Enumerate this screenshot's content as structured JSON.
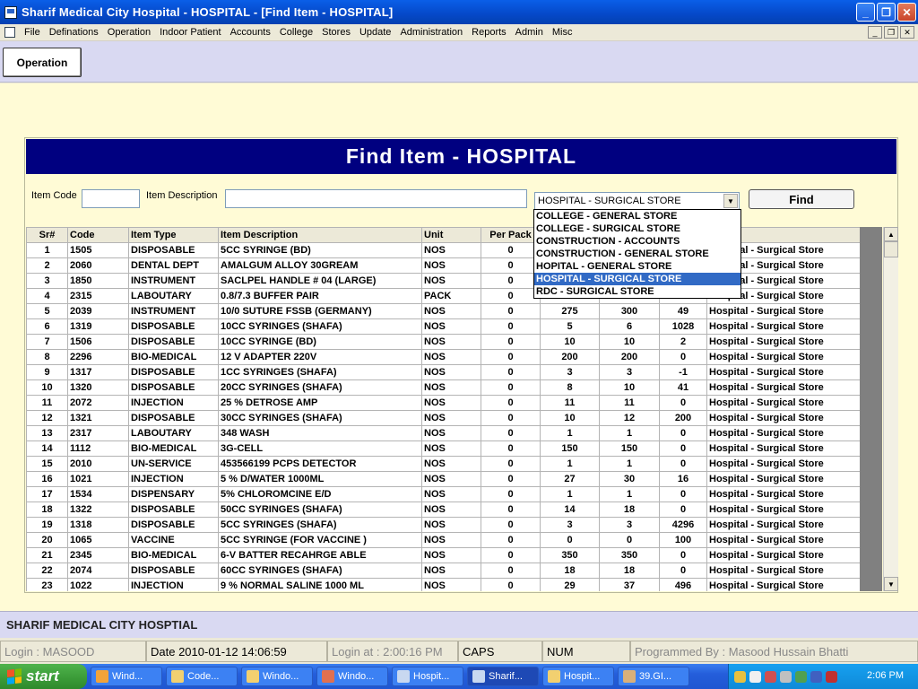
{
  "window": {
    "title": "Sharif Medical City Hospital - HOSPITAL - [Find Item - HOSPITAL]",
    "controls": [
      "_",
      "❐",
      "✕"
    ]
  },
  "menubar": {
    "items": [
      "File",
      "Definations",
      "Operation",
      "Indoor Patient",
      "Accounts",
      "College",
      "Stores",
      "Update",
      "Administration",
      "Reports",
      "Admin",
      "Misc"
    ],
    "mdi_controls": [
      "_",
      "❐",
      "✕"
    ]
  },
  "toolbar": {
    "operation_label": "Operation"
  },
  "find": {
    "header": "Find Item - HOSPITAL",
    "item_code_label": "Item Code",
    "item_code_value": "",
    "item_desc_label": "Item Description",
    "item_desc_value": "",
    "store_selected": "HOSPITAL - SURGICAL STORE",
    "find_label": "Find",
    "store_options": [
      "COLLEGE - GENERAL STORE",
      "COLLEGE - SURGICAL STORE",
      "CONSTRUCTION - ACCOUNTS",
      "CONSTRUCTION - GENERAL STORE",
      "HOPITAL - GENERAL STORE",
      "HOSPITAL - SURGICAL STORE",
      "RDC - SURGICAL STORE"
    ]
  },
  "grid": {
    "columns": [
      "Sr#",
      "Code",
      "Item Type",
      "Item Description",
      "Unit",
      "Per Pack",
      "",
      "",
      "",
      ""
    ],
    "rows": [
      [
        "1",
        "1505",
        "DISPOSABLE",
        " 5CC  SYRINGE (BD)",
        "NOS",
        "0",
        "",
        "",
        "",
        "Hospital - Surgical Store"
      ],
      [
        "2",
        "2060",
        "DENTAL DEPT",
        "  AMALGUM ALLOY 30GREAM",
        "NOS",
        "0",
        "",
        "",
        "",
        "Hospital - Surgical Store"
      ],
      [
        "3",
        "1850",
        "INSTRUMENT",
        "  SACLPEL HANDLE # 04 (LARGE)",
        "NOS",
        "0",
        "",
        "",
        "",
        "Hospital - Surgical Store"
      ],
      [
        "4",
        "2315",
        "LABOUTARY",
        "0.8/7.3 BUFFER PAIR",
        "PACK",
        "0",
        "",
        "",
        "",
        "Hospital - Surgical Store"
      ],
      [
        "5",
        "2039",
        "INSTRUMENT",
        "10/0 SUTURE FSSB (GERMANY)",
        "NOS",
        "0",
        "275",
        "300",
        "49",
        "Hospital - Surgical Store"
      ],
      [
        "6",
        "1319",
        "DISPOSABLE",
        "10CC  SYRINGES (SHAFA)",
        "NOS",
        "0",
        "5",
        "6",
        "1028",
        "Hospital - Surgical Store"
      ],
      [
        "7",
        "1506",
        "DISPOSABLE",
        "10CC SYRINGE  (BD)",
        "NOS",
        "0",
        "10",
        "10",
        "2",
        "Hospital - Surgical Store"
      ],
      [
        "8",
        "2296",
        "BIO-MEDICAL",
        "12 V ADAPTER 220V",
        "NOS",
        "0",
        "200",
        "200",
        "0",
        "Hospital - Surgical Store"
      ],
      [
        "9",
        "1317",
        "DISPOSABLE",
        "1CC  SYRINGES (SHAFA)",
        "NOS",
        "0",
        "3",
        "3",
        "-1",
        "Hospital - Surgical Store"
      ],
      [
        "10",
        "1320",
        "DISPOSABLE",
        "20CC  SYRINGES (SHAFA)",
        "NOS",
        "0",
        "8",
        "10",
        "41",
        "Hospital - Surgical Store"
      ],
      [
        "11",
        "2072",
        "INJECTION",
        "25 % DETROSE AMP",
        "NOS",
        "0",
        "11",
        "11",
        "0",
        "Hospital - Surgical Store"
      ],
      [
        "12",
        "1321",
        "DISPOSABLE",
        "30CC SYRINGES (SHAFA)",
        "NOS",
        "0",
        "10",
        "12",
        "200",
        "Hospital - Surgical Store"
      ],
      [
        "13",
        "2317",
        "LABOUTARY",
        "348 WASH",
        "NOS",
        "0",
        "1",
        "1",
        "0",
        "Hospital - Surgical Store"
      ],
      [
        "14",
        "1112",
        "BIO-MEDICAL",
        "3G-CELL",
        "NOS",
        "0",
        "150",
        "150",
        "0",
        "Hospital - Surgical Store"
      ],
      [
        "15",
        "2010",
        "UN-SERVICE",
        "453566199 PCPS DETECTOR",
        "NOS",
        "0",
        "1",
        "1",
        "0",
        "Hospital - Surgical Store"
      ],
      [
        "16",
        "1021",
        "INJECTION",
        "5 % D/WATER 1000ML",
        "NOS",
        "0",
        "27",
        "30",
        "16",
        "Hospital - Surgical Store"
      ],
      [
        "17",
        "1534",
        "DISPENSARY",
        "5% CHLOROMCINE  E/D",
        "NOS",
        "0",
        "1",
        "1",
        "0",
        "Hospital - Surgical Store"
      ],
      [
        "18",
        "1322",
        "DISPOSABLE",
        "50CC  SYRINGES (SHAFA)",
        "NOS",
        "0",
        "14",
        "18",
        "0",
        "Hospital - Surgical Store"
      ],
      [
        "19",
        "1318",
        "DISPOSABLE",
        "5CC  SYRINGES (SHAFA)",
        "NOS",
        "0",
        "3",
        "3",
        "4296",
        "Hospital - Surgical Store"
      ],
      [
        "20",
        "1065",
        "VACCINE",
        "5CC SYRINGE (FOR VACCINE )",
        "NOS",
        "0",
        "0",
        "0",
        "100",
        "Hospital - Surgical Store"
      ],
      [
        "21",
        "2345",
        "BIO-MEDICAL",
        "6-V BATTER RECAHRGE ABLE",
        "NOS",
        "0",
        "350",
        "350",
        "0",
        "Hospital - Surgical Store"
      ],
      [
        "22",
        "2074",
        "DISPOSABLE",
        "60CC  SYRINGES (SHAFA)",
        "NOS",
        "0",
        "18",
        "18",
        "0",
        "Hospital - Surgical Store"
      ],
      [
        "23",
        "1022",
        "INJECTION",
        "9 % NORMAL SALINE 1000 ML",
        "NOS",
        "0",
        "29",
        "37",
        "496",
        "Hospital - Surgical Store"
      ]
    ]
  },
  "footer": {
    "org": "SHARIF MEDICAL CITY HOSPTIAL"
  },
  "status": {
    "login": "Login :  MASOOD",
    "date": "Date 2010-01-12 14:06:59",
    "login_at": "Login at : 2:00:16 PM",
    "caps": "CAPS",
    "num": "NUM",
    "programmed": "Programmed By : Masood Hussain Bhatti"
  },
  "taskbar": {
    "start": "start",
    "tasks": [
      "Wind...",
      "Code...",
      "Windo...",
      "Windo...",
      "Hospit...",
      "Sharif...",
      "Hospit...",
      "39.GI..."
    ],
    "clock": "2:06 PM"
  },
  "colors": {
    "header_blue": "#000080",
    "cream": "#FFFBD6",
    "lavender": "#D9D9F2",
    "selection": "#316AC5"
  }
}
